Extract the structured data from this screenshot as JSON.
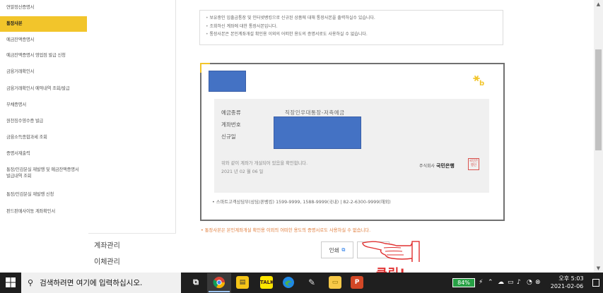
{
  "sidebar": {
    "items": [
      {
        "label": "연말정산증명서"
      },
      {
        "label": "통장사본"
      },
      {
        "label": "예금잔액증명서"
      },
      {
        "label": "예금잔액증명서 영업점 발급 신청"
      },
      {
        "label": "금융거래확인서"
      },
      {
        "label": "금융거래확인서 예약내역 조회/발급"
      },
      {
        "label": "부채증명서"
      },
      {
        "label": "원천징수영수증 발급"
      },
      {
        "label": "금융소득종합과세 조회"
      },
      {
        "label": "증명서재출력"
      },
      {
        "label": "통장/인감분실 재발행 및 예금잔액증명서 발급내역 조회"
      },
      {
        "label": "통장/인감분실 재발행 신청"
      },
      {
        "label": "펀드판매사이동 계좌확인서"
      }
    ],
    "sections": [
      {
        "label": "계좌관리"
      },
      {
        "label": "이체관리"
      }
    ]
  },
  "notice": {
    "lines": [
      "보유중인 입출금통장 및 인터넷뱅킹으로 신규된 상품에 대해 통장사본을 출력하실수 있습니다.",
      "조회하신 계좌에 대한 통장사본입니다.",
      "통장사본은 본인계좌개설 확인용 이외의 어떠한 용도의 증명서로도 사용하실 수 없습니다."
    ]
  },
  "passbook": {
    "fields": {
      "type_label": "예금종류",
      "account_label": "계좌번호",
      "opened_label": "신규일"
    },
    "account_type": "직장인우대통장-저축예금",
    "confirm_text": "위와 같이 계좌가 개설되어 있음을 확인합니다.",
    "confirm_date": "2021 년 02 월 06 일",
    "bank_prefix": "주식회사",
    "bank_name": "국민은행",
    "seal_text": "국민은행인"
  },
  "contact": "스마트고객상담부(상담/폰뱅킹) 1599-9999, 1588-9999(국내) | 82-2-6300-9999(해외)",
  "warning": "통장사본은 본인계좌개설 확인용 이외의 어떠한 용도의 증명서로도 사용하실 수 없습니다.",
  "actions": {
    "print_label": "인쇄",
    "click_annotation": "클릭!"
  },
  "taskbar": {
    "search_placeholder": "검색하려면 여기에 입력하십시오.",
    "battery": "84%",
    "time": "오후 5:03",
    "date": "2021-02-06"
  },
  "colors": {
    "accent": "#f2c52b",
    "redaction": "#4472c4",
    "warning": "#e07b39",
    "annotation": "#e03030"
  }
}
